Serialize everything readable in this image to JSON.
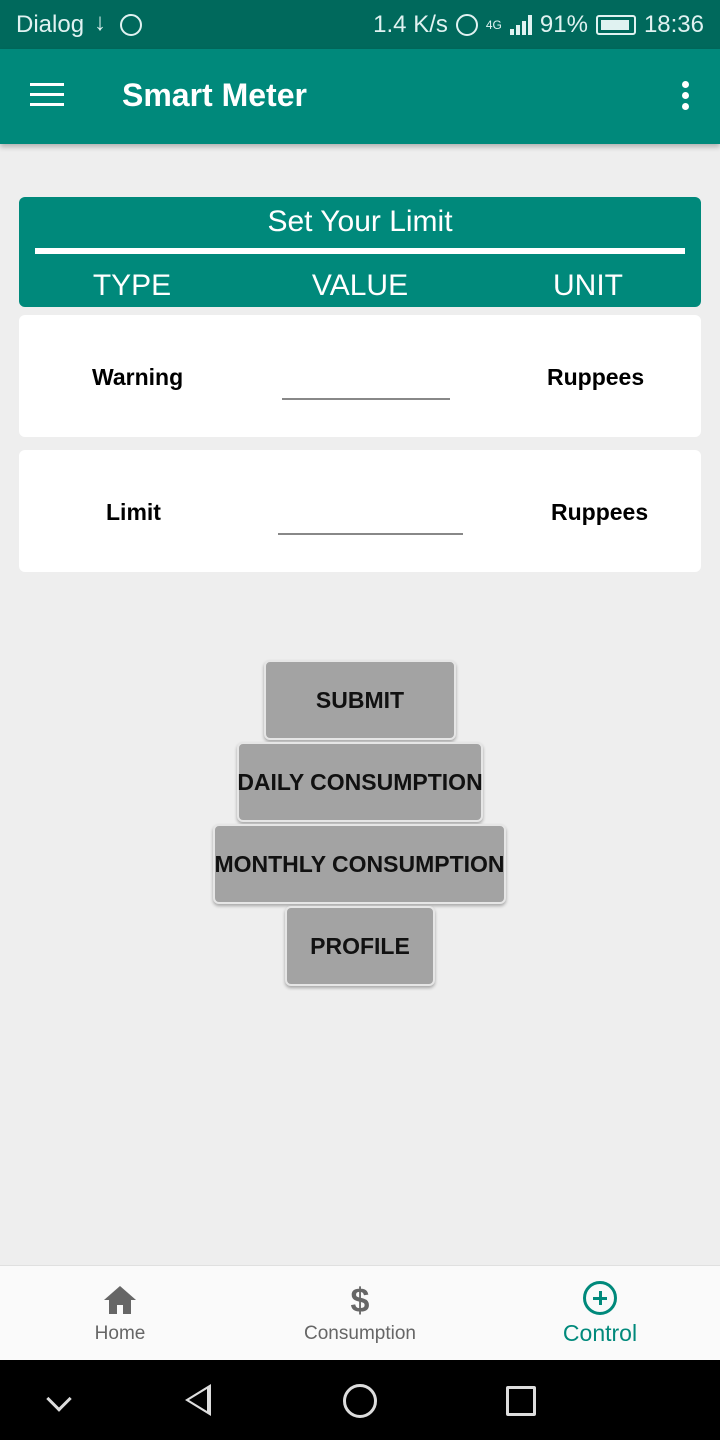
{
  "status_bar": {
    "carrier": "Dialog",
    "speed": "1.4 K/s",
    "network": "4G",
    "battery": "91%",
    "time": "18:36"
  },
  "app_bar": {
    "title": "Smart Meter"
  },
  "limit_section": {
    "title": "Set Your Limit",
    "columns": [
      "TYPE",
      "VALUE",
      "UNIT"
    ],
    "rows": [
      {
        "type": "Warning",
        "value": "",
        "unit": "Ruppees"
      },
      {
        "type": "Limit",
        "value": "",
        "unit": "Ruppees"
      }
    ]
  },
  "buttons": {
    "submit": "SUBMIT",
    "daily": "DAILY CONSUMPTION",
    "monthly": "MONTHLY CONSUMPTION",
    "profile": "PROFILE"
  },
  "bottom_nav": {
    "items": [
      {
        "label": "Home",
        "icon": "home-icon"
      },
      {
        "label": "Consumption",
        "icon": "dollar-icon"
      },
      {
        "label": "Control",
        "icon": "plus-circle-icon",
        "active": true
      }
    ]
  },
  "colors": {
    "primary": "#00897b",
    "primary_dark": "#00695c",
    "button": "#a3a3a3"
  }
}
